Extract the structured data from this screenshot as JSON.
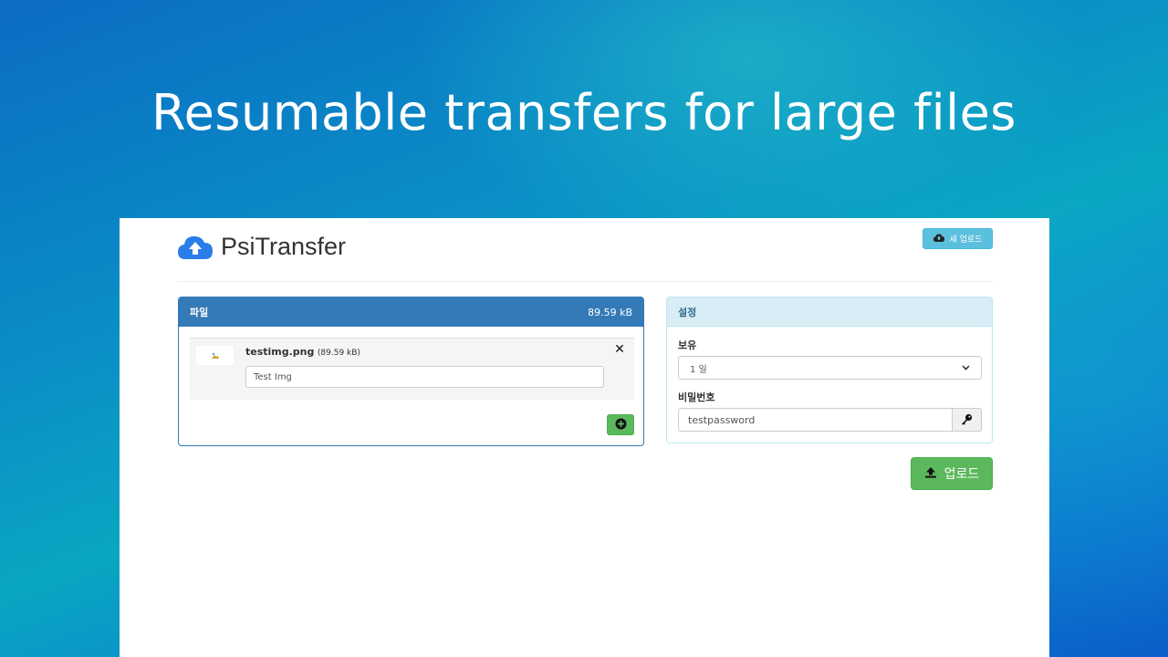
{
  "headline": "Resumable transfers for large files",
  "app": {
    "brand_name": "PsiTransfer",
    "new_upload_label": "새 업로드",
    "files_panel": {
      "title": "파일",
      "total_size": "89.59 kB",
      "items": [
        {
          "name": "testimg.png",
          "size": "(89.59 kB)",
          "comment": "Test Img",
          "remove_symbol": "✕"
        }
      ]
    },
    "settings_panel": {
      "title": "설정",
      "retention_label": "보유",
      "retention_value": "1 일",
      "password_label": "비밀번호",
      "password_value": "testpassword"
    },
    "upload_label": "업로드"
  },
  "colors": {
    "primary": "#337ab7",
    "success": "#5cb85c",
    "info": "#5bc0de",
    "info_panel_bg": "#d9edf7",
    "brand_icon": "#2b7de9"
  },
  "icons": {
    "brand": "cloud-upload-icon",
    "new_upload": "cloud-upload-icon",
    "thumbnail": "image-icon",
    "remove": "close-icon",
    "add": "plus-circle-icon",
    "select": "chevron-down-icon",
    "password_generate": "key-icon",
    "upload": "upload-icon"
  }
}
